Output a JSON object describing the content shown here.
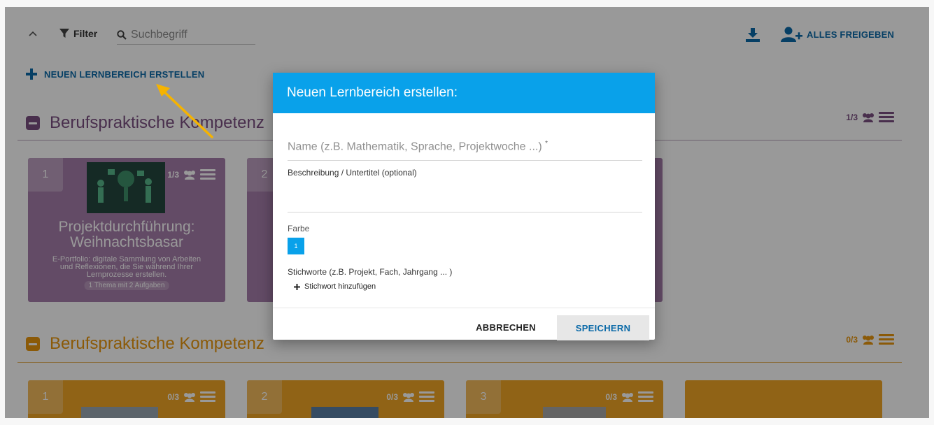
{
  "toolbar": {
    "filter_label": "Filter",
    "search_placeholder": "Suchbegriff",
    "share_all_label": "ALLES FREIGEBEN"
  },
  "new_area_label": "NEUEN LERNBEREICH ERSTELLEN",
  "sections": [
    {
      "title": "Berufspraktische Kompetenz",
      "count": "1/3",
      "color": "#7a4f80",
      "cards": [
        {
          "number": "1",
          "count": "1/3",
          "title_line1": "Projektdurchführung:",
          "title_line2": "Weihnachtsbasar",
          "desc_line1": "E-Portfolio: digitale Sammlung von Arbeiten",
          "desc_line2": "und Reflexionen, die Sie während Ihrer",
          "desc_line3": "Lernprozesse erstellen.",
          "summary": "1 Thema mit 2 Aufgaben"
        },
        {
          "number": "2"
        }
      ]
    },
    {
      "title": "Berufspraktische Kompetenz",
      "count": "0/3",
      "color": "#e8960e",
      "cards": [
        {
          "number": "1",
          "count": "0/3"
        },
        {
          "number": "2",
          "count": "0/3"
        },
        {
          "number": "3",
          "count": "0/3"
        }
      ]
    }
  ],
  "dialog": {
    "title": "Neuen Lernbereich erstellen:",
    "name_placeholder": "Name (z.B. Mathematik, Sprache, Projektwoche ...)",
    "required_mark": "*",
    "description_label": "Beschreibung / Untertitel (optional)",
    "color_label": "Farbe",
    "color_swatch_label": "1",
    "color_value": "#09a1ea",
    "tags_label": "Stichworte (z.B. Projekt, Fach, Jahrgang ... )",
    "add_tag_label": "Stichwort hinzufügen",
    "cancel_label": "ABBRECHEN",
    "save_label": "SPEICHERN"
  },
  "colors": {
    "accent_blue": "#09a1ea",
    "link_blue": "#0b6aa8",
    "annotation_arrow": "#f5b301"
  }
}
